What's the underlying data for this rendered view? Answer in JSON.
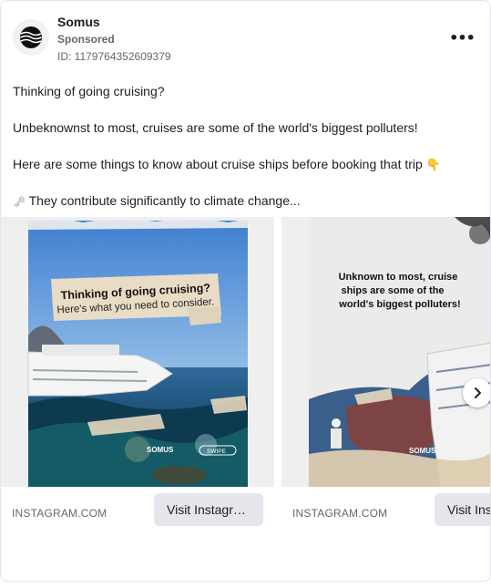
{
  "post": {
    "brand": "Somus",
    "sponsored": "Sponsored",
    "ad_id": "ID: 1179764352609379",
    "more_label": "•••",
    "lines": [
      "Thinking of going cruising?",
      "Unbeknownst to most, cruises are some of the world's biggest polluters!",
      "Here are some things to know about cruise ships before booking that trip",
      "They contribute significantly to climate change..."
    ],
    "line3_emoji": "👇",
    "line4_emoji": "🗝"
  },
  "carousel": {
    "slides": [
      {
        "poster_line1": "Thinking of going cruising?",
        "poster_line2": "Here's what you need to consider.",
        "logo_text": "SOMUS",
        "swipe_text": "SWIPE",
        "source": "INSTAGRAM.COM",
        "cta": "Visit Instagram profile"
      },
      {
        "poster_line1": "Unknown to most, cruise",
        "poster_line2": "ships are some of the",
        "poster_line3": "world's biggest polluters!",
        "logo_text": "SOMUS",
        "source": "INSTAGRAM.COM",
        "cta": "Visit Instagram profile"
      }
    ],
    "next_icon": "chevron-right-icon"
  }
}
